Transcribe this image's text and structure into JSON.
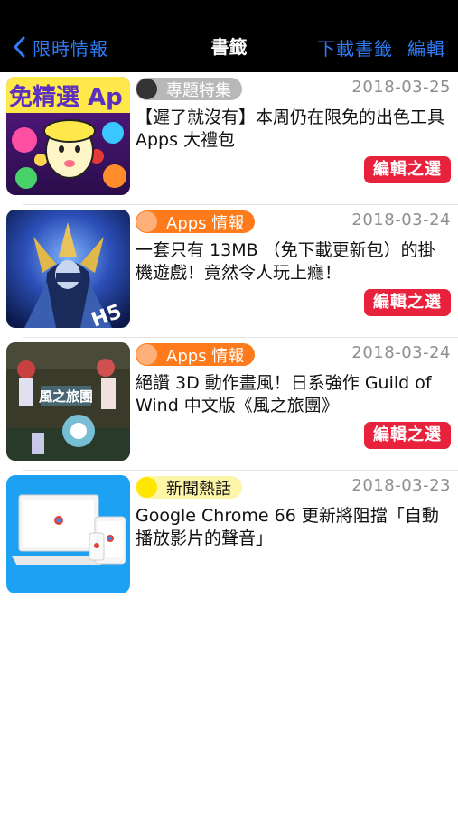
{
  "nav": {
    "back_label": "限時情報",
    "title": "書籤",
    "download_label": "下載書籤",
    "edit_label": "編輯"
  },
  "colors": {
    "nav_background": "#000000",
    "accent_blue": "#2f7cf6",
    "editor_pick_red": "#e8223d",
    "badge_topic_bg": "#b8b8b8",
    "badge_topic_dot": "#333333",
    "badge_apps_bg": "#ff7a1a",
    "badge_apps_dot": "#ffb07a",
    "badge_news_bg": "#fdf5a8",
    "badge_news_dot": "#ffe600"
  },
  "items": [
    {
      "category": "專題特集",
      "category_style": "topic",
      "date": "2018-03-25",
      "title": "【遲了就沒有】本周仍在限免的出色工具 Apps 大禮包",
      "editor_pick": "編輯之選",
      "thumb_icon": "app-bundle-thumbnail",
      "thumb_text": "免精選 Ap"
    },
    {
      "category": "Apps 情報",
      "category_style": "apps",
      "date": "2018-03-24",
      "title": "一套只有 13MB （免下載更新包）的掛機遊戲！竟然令人玩上癮！",
      "editor_pick": "編輯之選",
      "thumb_icon": "game-warrior-thumbnail",
      "thumb_text": "H5"
    },
    {
      "category": "Apps 情報",
      "category_style": "apps",
      "date": "2018-03-24",
      "title": "絕讚 3D 動作畫風！日系強作 Guild of Wind 中文版《風之旅團》",
      "editor_pick": "編輯之選",
      "thumb_icon": "game-battle-thumbnail",
      "thumb_text": "風之旅團"
    },
    {
      "category": "新聞熱話",
      "category_style": "news",
      "date": "2018-03-23",
      "title": "Google Chrome 66 更新將阻擋「自動播放影片的聲音」",
      "editor_pick": "",
      "thumb_icon": "chrome-devices-thumbnail",
      "thumb_text": ""
    }
  ]
}
